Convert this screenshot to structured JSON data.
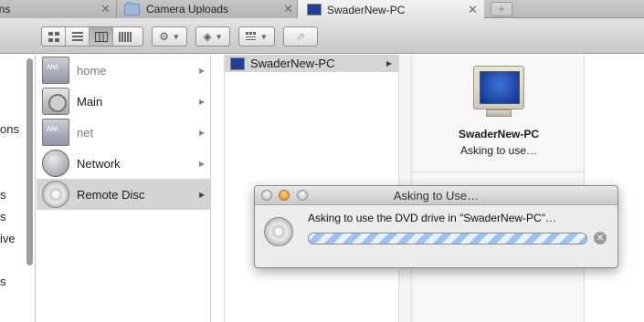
{
  "tabs": [
    {
      "label": "ons"
    },
    {
      "label": "Camera Uploads"
    },
    {
      "label": "SwaderNew-PC"
    }
  ],
  "tab_close_glyph": "✕",
  "new_tab_glyph": "+",
  "toolbar": {
    "view_modes": [
      "icon-view",
      "list-view",
      "column-view",
      "coverflow-view"
    ],
    "active_view": "column-view"
  },
  "sidebar": {
    "fragments": [
      "ons",
      "s",
      "s",
      "ive",
      "s"
    ]
  },
  "column1": {
    "items": [
      {
        "label": "home",
        "dimmed": true,
        "icon": "network-share-icon"
      },
      {
        "label": "Main",
        "dimmed": false,
        "icon": "hard-drive-icon"
      },
      {
        "label": "net",
        "dimmed": true,
        "icon": "network-share-icon"
      },
      {
        "label": "Network",
        "dimmed": false,
        "icon": "network-globe-icon"
      },
      {
        "label": "Remote Disc",
        "dimmed": false,
        "selected": true,
        "icon": "disc-icon"
      }
    ]
  },
  "column2": {
    "items": [
      {
        "label": "SwaderNew-PC",
        "selected": true
      }
    ]
  },
  "preview": {
    "name": "SwaderNew-PC",
    "status": "Asking to use…"
  },
  "dialog": {
    "title": "Asking to Use…",
    "message": "Asking to use the DVD drive in \"SwaderNew-PC\"…",
    "progress": "indeterminate",
    "cancel_glyph": "✕"
  },
  "arrow_glyph": "▶"
}
